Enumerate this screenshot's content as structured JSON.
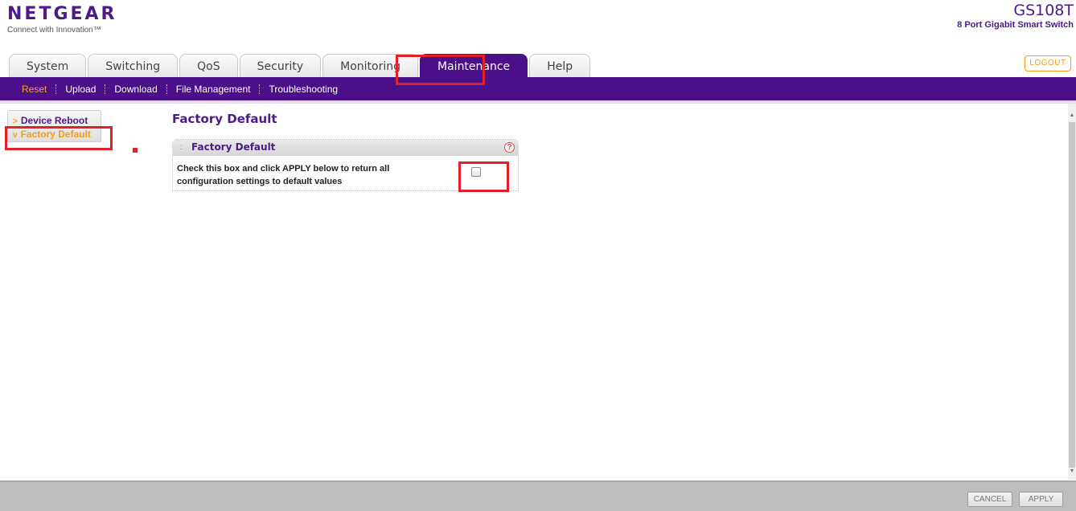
{
  "header": {
    "brand": "NETGEAR",
    "tagline": "Connect with Innovation™",
    "model_name": "GS108T",
    "model_desc": "8 Port Gigabit Smart Switch",
    "logout_label": "LOGOUT"
  },
  "tabs": [
    {
      "label": "System"
    },
    {
      "label": "Switching"
    },
    {
      "label": "QoS"
    },
    {
      "label": "Security"
    },
    {
      "label": "Monitoring"
    },
    {
      "label": "Maintenance",
      "active": true
    },
    {
      "label": "Help"
    }
  ],
  "subnav": [
    {
      "label": "Reset",
      "active": true
    },
    {
      "label": "Upload"
    },
    {
      "label": "Download"
    },
    {
      "label": "File Management"
    },
    {
      "label": "Troubleshooting"
    }
  ],
  "leftnav": {
    "items": [
      {
        "label": "Device Reboot",
        "arrow": ">"
      },
      {
        "label": "Factory Default",
        "arrow": "v",
        "active": true
      }
    ]
  },
  "content": {
    "page_title": "Factory Default",
    "panel_title": "Factory Default",
    "panel_grip": "::",
    "help_symbol": "?",
    "instruction": "Check this box and click APPLY below to return all configuration settings to default values",
    "factory_default_checked": false
  },
  "scroll": {
    "up_symbol": "▲",
    "down_symbol": "▼"
  },
  "footer": {
    "cancel_label": "CANCEL",
    "apply_label": "APPLY"
  },
  "colors": {
    "brand_purple": "#4b0f8a",
    "accent_orange": "#f39c12",
    "highlight_red": "#e2202c"
  }
}
